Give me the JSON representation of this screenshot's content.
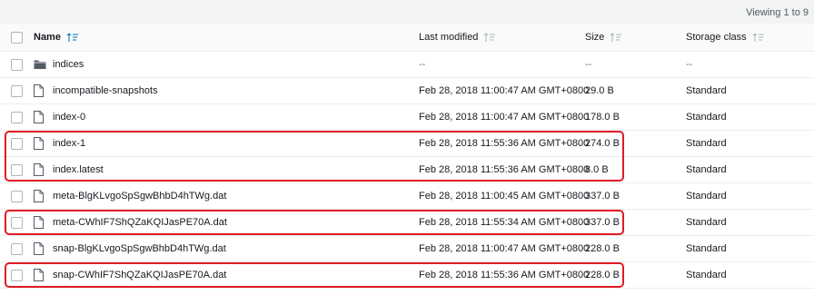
{
  "viewing": "Viewing 1 to 9",
  "columns": {
    "name": "Name",
    "last_modified": "Last modified",
    "size": "Size",
    "storage_class": "Storage class"
  },
  "rows": [
    {
      "icon": "folder-icon",
      "name": "indices",
      "modified": "--",
      "size": "--",
      "storage": "--"
    },
    {
      "icon": "file-icon",
      "name": "incompatible-snapshots",
      "modified": "Feb 28, 2018 11:00:47 AM GMT+0800",
      "size": "29.0 B",
      "storage": "Standard"
    },
    {
      "icon": "file-icon",
      "name": "index-0",
      "modified": "Feb 28, 2018 11:00:47 AM GMT+0800",
      "size": "178.0 B",
      "storage": "Standard"
    },
    {
      "icon": "file-icon",
      "name": "index-1",
      "modified": "Feb 28, 2018 11:55:36 AM GMT+0800",
      "size": "274.0 B",
      "storage": "Standard",
      "highlighted": true
    },
    {
      "icon": "file-icon",
      "name": "index.latest",
      "modified": "Feb 28, 2018 11:55:36 AM GMT+0800",
      "size": "8.0 B",
      "storage": "Standard",
      "highlighted": true
    },
    {
      "icon": "file-icon",
      "name": "meta-BlgKLvgoSpSgwBhbD4hTWg.dat",
      "modified": "Feb 28, 2018 11:00:45 AM GMT+0800",
      "size": "337.0 B",
      "storage": "Standard"
    },
    {
      "icon": "file-icon",
      "name": "meta-CWhIF7ShQZaKQIJasPE70A.dat",
      "modified": "Feb 28, 2018 11:55:34 AM GMT+0800",
      "size": "337.0 B",
      "storage": "Standard",
      "highlighted": true
    },
    {
      "icon": "file-icon",
      "name": "snap-BlgKLvgoSpSgwBhbD4hTWg.dat",
      "modified": "Feb 28, 2018 11:00:47 AM GMT+0800",
      "size": "228.0 B",
      "storage": "Standard"
    },
    {
      "icon": "file-icon",
      "name": "snap-CWhIF7ShQZaKQIJasPE70A.dat",
      "modified": "Feb 28, 2018 11:55:36 AM GMT+0800",
      "size": "228.0 B",
      "storage": "Standard",
      "highlighted": true
    }
  ],
  "colors": {
    "highlight": "#e01b24",
    "sort_active": "#0073bb",
    "sort_inactive": "#aab7b8"
  }
}
